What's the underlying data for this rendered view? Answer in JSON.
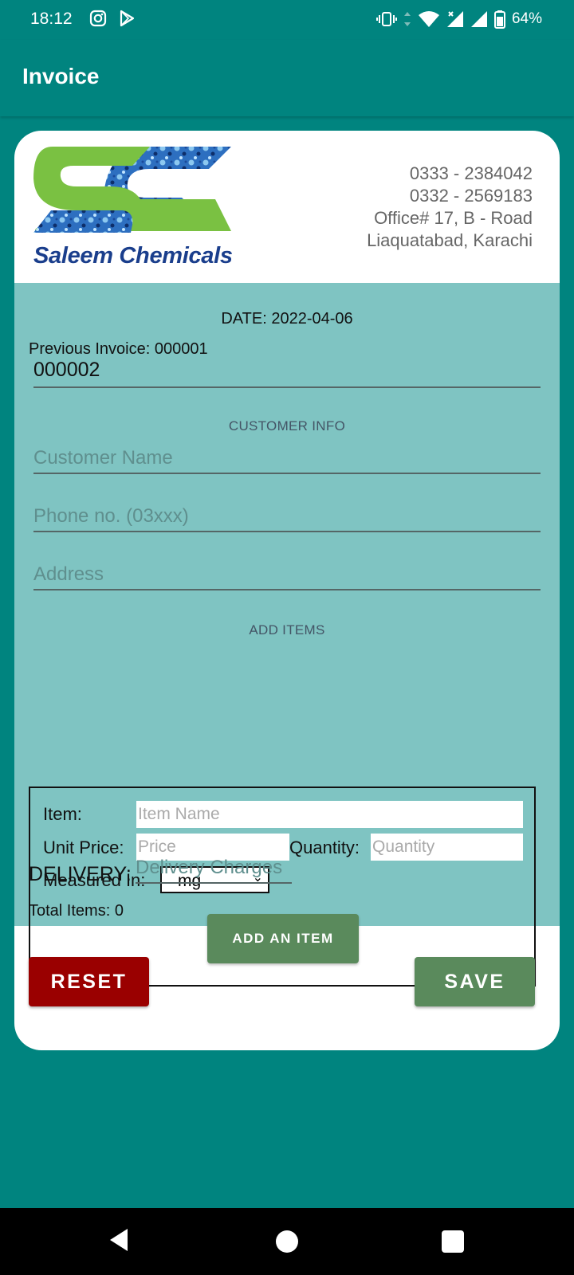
{
  "status_bar": {
    "time": "18:12",
    "battery": "64%"
  },
  "app_bar": {
    "title": "Invoice"
  },
  "header": {
    "logo_text": "Saleem Chemicals",
    "contact_lines": [
      "0333 - 2384042",
      "0332 - 2569183",
      "Office# 17, B - Road",
      "Liaquatabad, Karachi"
    ]
  },
  "form": {
    "date_text": "DATE: 2022-04-06",
    "previous_invoice": "Previous Invoice: 000001",
    "invoice_number": "000002",
    "customer_section": "CUSTOMER INFO",
    "customer_name_placeholder": "Customer Name",
    "phone_placeholder": "Phone no. (03xxx)",
    "address_placeholder": "Address",
    "items_section": "ADD ITEMS"
  },
  "item_box": {
    "item_label": "Item:",
    "item_placeholder": "Item Name",
    "unit_price_label": "Unit Price:",
    "price_placeholder": "Price",
    "quantity_label": "Quantity:",
    "quantity_placeholder": "Quantity",
    "measured_label": "Measured In:",
    "measured_value": "mg",
    "add_button": "ADD AN ITEM"
  },
  "delivery": {
    "label": "DELIVERY:",
    "placeholder": "Delivery Charges"
  },
  "total_items": "Total Items: 0",
  "buttons": {
    "reset": "RESET",
    "save": "SAVE"
  },
  "colors": {
    "teal": "#00847f",
    "form_bg": "#7fc4c2",
    "reset": "#9a0000",
    "save": "#5a8a5c"
  }
}
